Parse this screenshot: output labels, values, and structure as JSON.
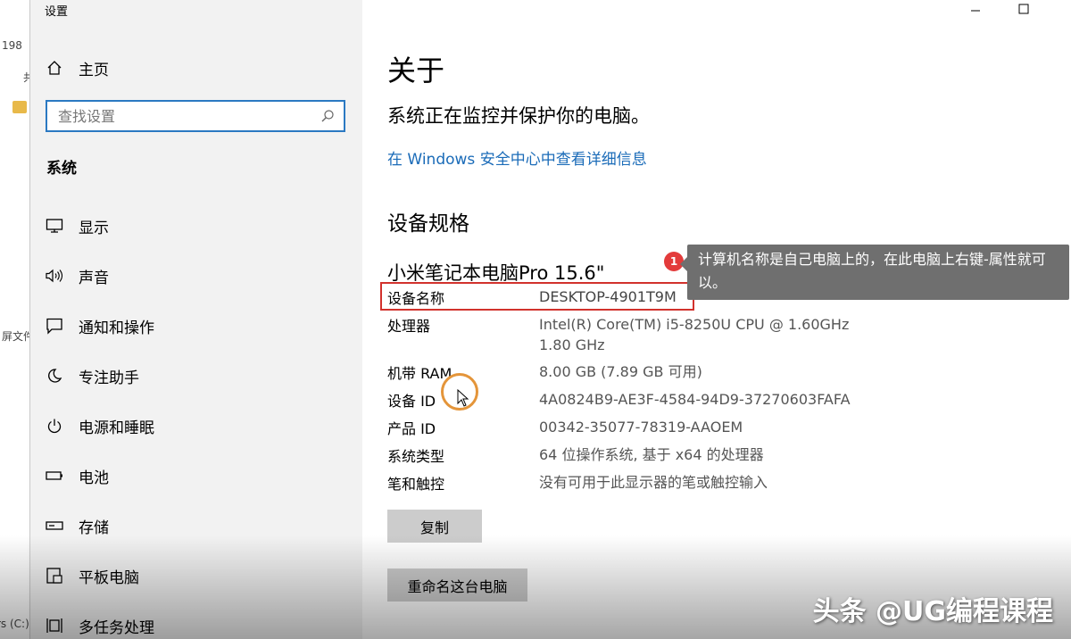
{
  "background_window": {
    "top_number": "198",
    "side_char": "共",
    "frag1": "屏文件",
    "frag2": "rs (C:)"
  },
  "sidebar": {
    "app_title": "设置",
    "home_label": "主页",
    "search_placeholder": "查找设置",
    "section_label": "系统",
    "items": [
      {
        "label": "显示",
        "icon": "monitor-icon"
      },
      {
        "label": "声音",
        "icon": "speaker-icon"
      },
      {
        "label": "通知和操作",
        "icon": "notification-icon"
      },
      {
        "label": "专注助手",
        "icon": "moon-icon"
      },
      {
        "label": "电源和睡眠",
        "icon": "power-icon"
      },
      {
        "label": "电池",
        "icon": "battery-icon"
      },
      {
        "label": "存储",
        "icon": "storage-icon"
      },
      {
        "label": "平板电脑",
        "icon": "tablet-icon"
      },
      {
        "label": "多任务处理",
        "icon": "multitask-icon"
      }
    ]
  },
  "main": {
    "title": "关于",
    "protect_text": "系统正在监控并保护你的电脑。",
    "security_link": "在 Windows 安全中心中查看详细信息",
    "spec_heading": "设备规格",
    "device_model": "小米笔记本电脑Pro 15.6\"",
    "specs": [
      {
        "key": "设备名称",
        "value": "DESKTOP-4901T9M"
      },
      {
        "key": "处理器",
        "value": "Intel(R) Core(TM) i5-8250U CPU @ 1.60GHz",
        "value2": "1.80 GHz"
      },
      {
        "key": "机带 RAM",
        "value": "8.00 GB (7.89 GB 可用)"
      },
      {
        "key": "设备 ID",
        "value": "4A0824B9-AE3F-4584-94D9-37270603FAFA"
      },
      {
        "key": "产品 ID",
        "value": "00342-35077-78319-AAOEM"
      },
      {
        "key": "系统类型",
        "value": "64 位操作系统, 基于 x64 的处理器"
      },
      {
        "key": "笔和触控",
        "value": "没有可用于此显示器的笔或触控输入"
      }
    ],
    "copy_button": "复制",
    "rename_button": "重命名这台电脑"
  },
  "callout": {
    "badge": "1",
    "text": "计算机名称是自己电脑上的，在此电脑上右键-属性就可以。"
  },
  "watermark": "头条 @UG编程课程",
  "colors": {
    "accent": "#2b79c2",
    "link": "#1a6bb8",
    "highlight": "#d2322d",
    "callout_bg": "#6f6f6f",
    "badge": "#e33b3b",
    "cursor_ring": "#e4953a"
  }
}
